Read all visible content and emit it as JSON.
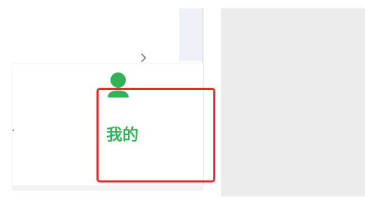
{
  "tabbar": {
    "me_tab": {
      "label": "我的",
      "icon": "user-icon",
      "accent_color": "#34b25a"
    }
  },
  "highlight": {
    "color": "#e12c2c"
  },
  "icons": {
    "chevron": "chevron-right-icon"
  }
}
